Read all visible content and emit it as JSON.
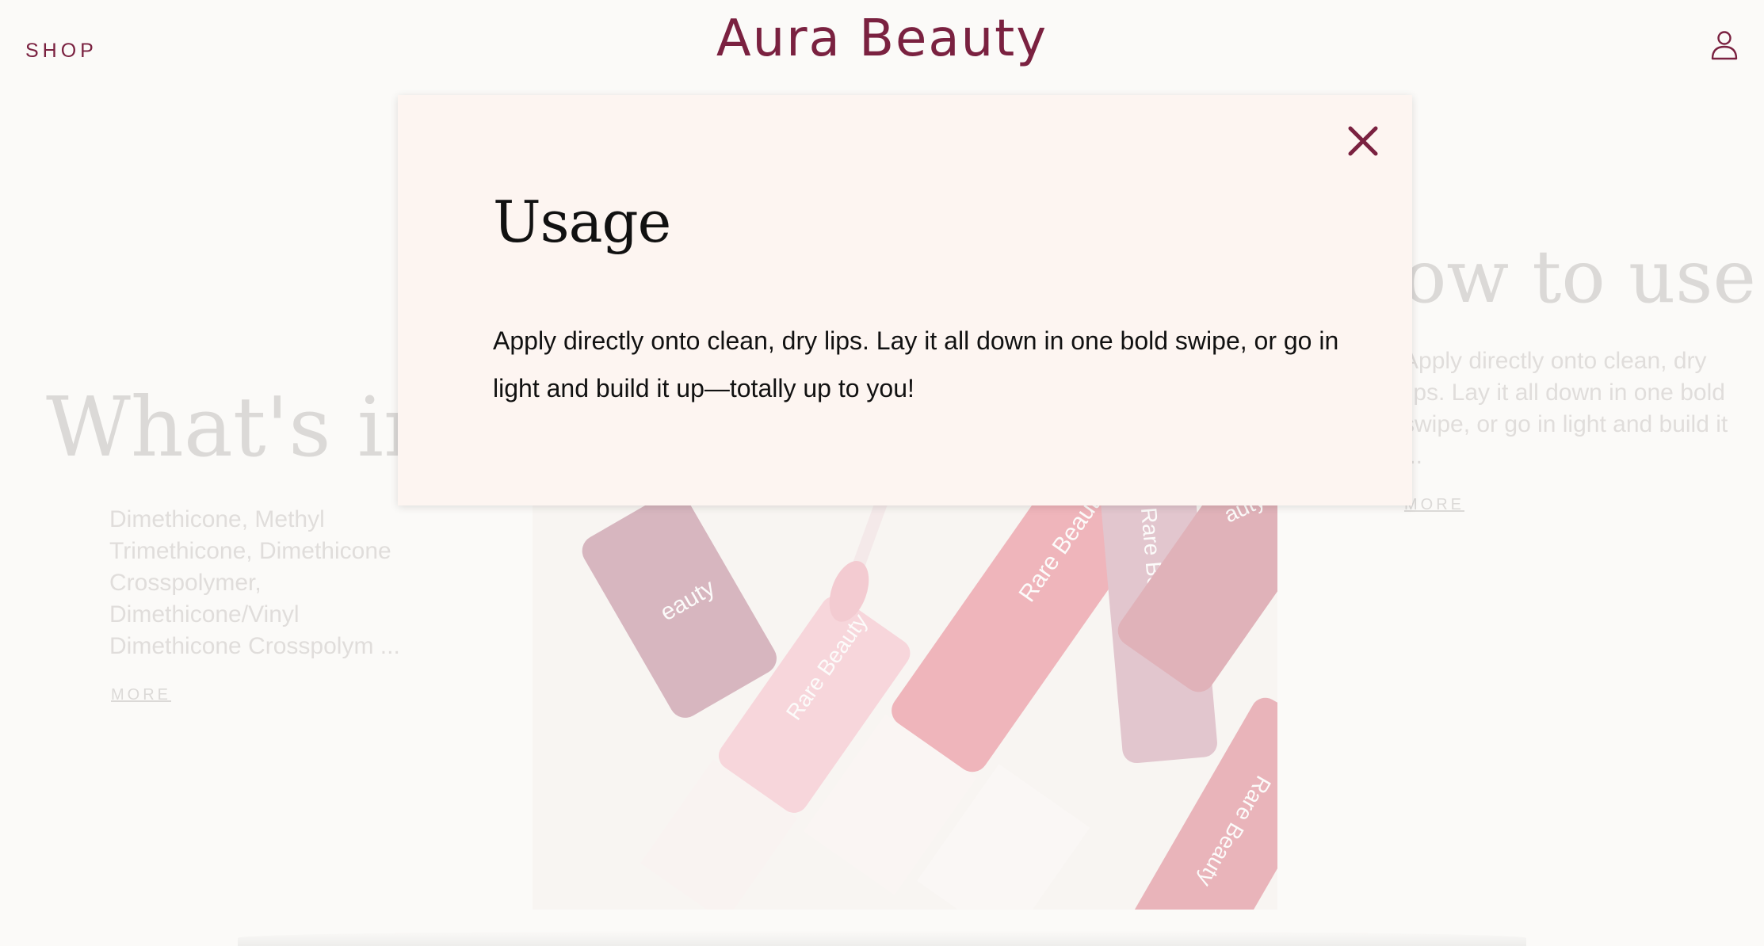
{
  "header": {
    "shop_label": "SHOP",
    "brand": "Aura Beauty",
    "account_icon": "user-account-icon"
  },
  "background": {
    "ingredients_title": "What's in i",
    "ingredients_text": "Dimethicone, Methyl Trimethicone, Dimethicone Crosspolymer, Dimethicone/Vinyl Dimethicone Crosspolym ...",
    "ingredients_more": "MORE",
    "howto_title": "ow to use",
    "howto_text": "Apply directly onto clean, dry lips. Lay it all down in one bold swipe, or go in light and build it ...",
    "howto_more": "MORE",
    "product_labels": [
      "eauty",
      "Rare Beauty",
      "Rare Beauty",
      "auty",
      "Rare Beauty",
      "Rare Beauty"
    ]
  },
  "modal": {
    "title": "Usage",
    "body": "Apply directly onto clean, dry lips. Lay it all down in one bold swipe, or go in light and build it up—totally up to you!",
    "close_icon": "close-icon"
  },
  "colors": {
    "brand": "#7a2140",
    "modal_bg": "#fdf5f1",
    "page_bg": "#fbfaf8"
  }
}
